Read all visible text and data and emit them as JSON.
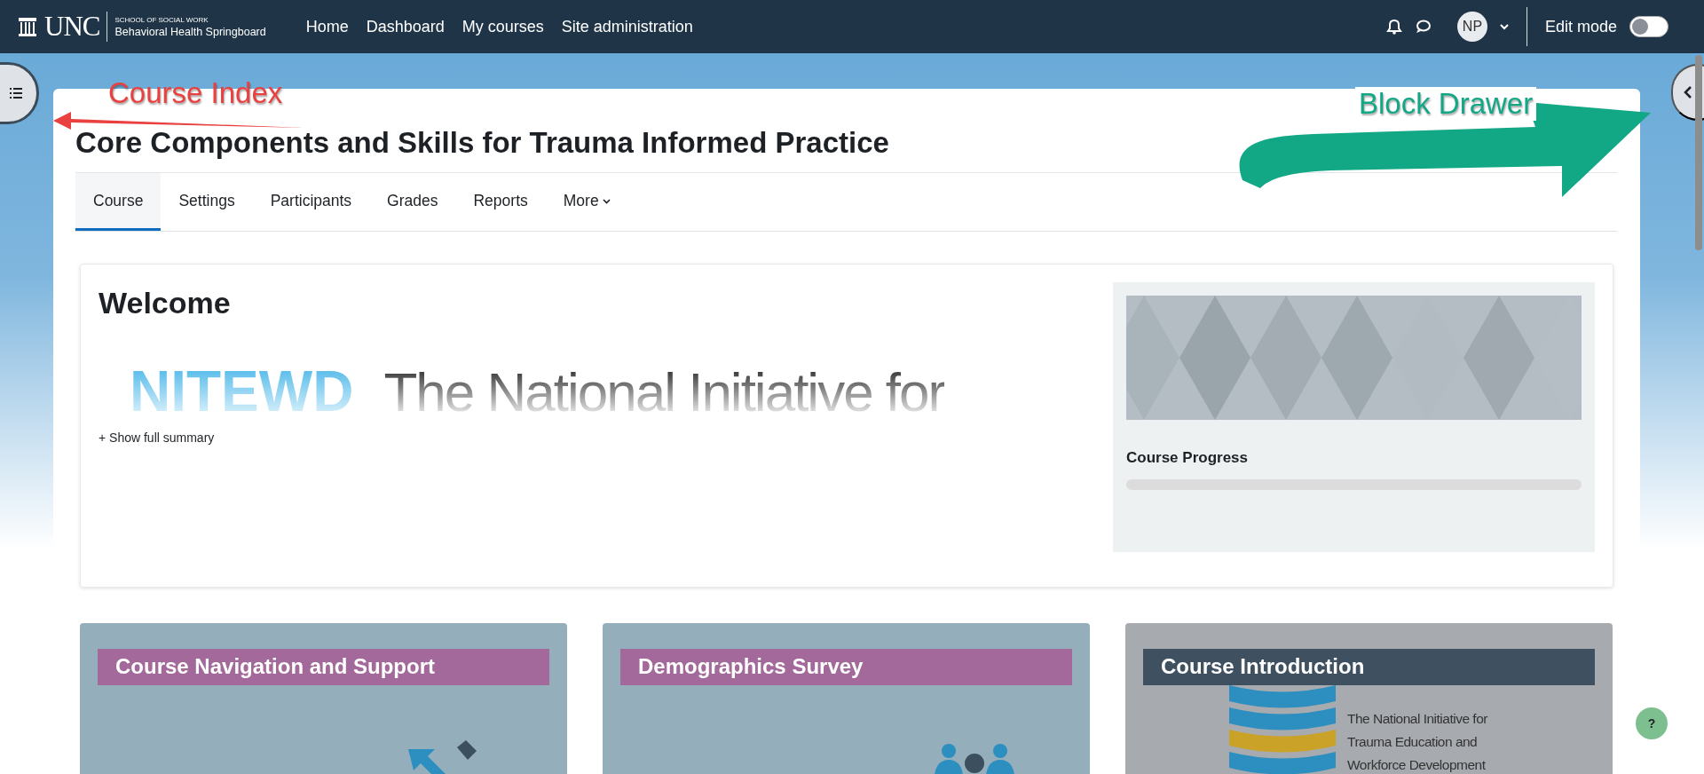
{
  "header": {
    "logo": {
      "wordmark": "UNC",
      "school": "SCHOOL OF SOCIAL WORK",
      "site": "Behavioral Health Springboard"
    },
    "nav": [
      {
        "label": "Home"
      },
      {
        "label": "Dashboard"
      },
      {
        "label": "My courses"
      },
      {
        "label": "Site administration"
      }
    ],
    "avatar": "NP",
    "edit_mode": {
      "label": "Edit mode",
      "on": false
    }
  },
  "annotations": [
    {
      "kind": "left",
      "text": "Course Index",
      "color": "#e8413f"
    },
    {
      "kind": "right",
      "text": "Block Drawer",
      "color": "#12a886"
    }
  ],
  "course": {
    "title": "Core Components and Skills for Trauma Informed Practice",
    "tabs": [
      {
        "label": "Course",
        "selected": true
      },
      {
        "label": "Settings",
        "selected": false
      },
      {
        "label": "Participants",
        "selected": false
      },
      {
        "label": "Grades",
        "selected": false
      },
      {
        "label": "Reports",
        "selected": false
      },
      {
        "label": "More",
        "selected": false,
        "menu": true
      }
    ]
  },
  "welcome": {
    "heading": "Welcome",
    "banner": {
      "acronym": "NITEWD",
      "tagline": "The National Initiative for"
    },
    "summary_link": "+ Show full summary",
    "progress": {
      "label": "Course Progress",
      "level": 0
    }
  },
  "sections": [
    {
      "title": "Course Navigation and Support",
      "kind": "arrow",
      "color": "#a3699a"
    },
    {
      "title": "Demographics Survey",
      "kind": "people",
      "color": "#a3699a"
    },
    {
      "title": "Course Introduction",
      "kind": "book",
      "color": "#3f5161",
      "caption": [
        "The National Initiative for",
        "Trauma Education and",
        "Workforce Development"
      ]
    }
  ],
  "help": "?"
}
